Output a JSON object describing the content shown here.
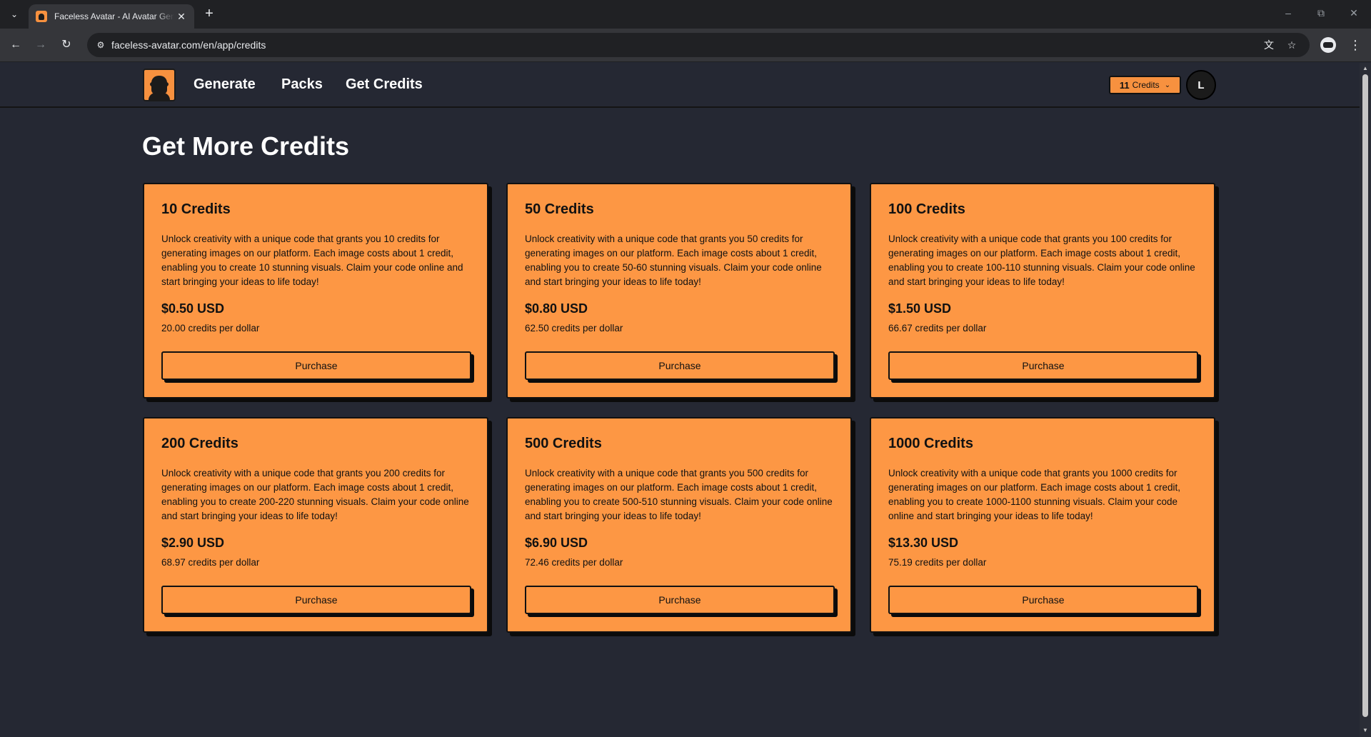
{
  "browser": {
    "tab_title": "Faceless Avatar - AI Avatar Generator",
    "url": "faceless-avatar.com/en/app/credits"
  },
  "nav": {
    "links": [
      "Generate",
      "Packs",
      "Get Credits"
    ],
    "credits_count": "11",
    "credits_label": "Credits",
    "avatar_initial": "L"
  },
  "page": {
    "title": "Get More Credits",
    "purchase_label": "Purchase"
  },
  "packs": [
    {
      "title": "10 Credits",
      "description": "Unlock creativity with a unique code that grants you 10 credits for generating images on our platform. Each image costs about 1 credit, enabling you to create 10 stunning visuals. Claim your code online and start bringing your ideas to life today!",
      "price": "$0.50 USD",
      "rate": "20.00 credits per dollar"
    },
    {
      "title": "50 Credits",
      "description": "Unlock creativity with a unique code that grants you 50 credits for generating images on our platform. Each image costs about 1 credit, enabling you to create 50-60 stunning visuals. Claim your code online and start bringing your ideas to life today!",
      "price": "$0.80 USD",
      "rate": "62.50 credits per dollar"
    },
    {
      "title": "100 Credits",
      "description": "Unlock creativity with a unique code that grants you 100 credits for generating images on our platform. Each image costs about 1 credit, enabling you to create 100-110 stunning visuals. Claim your code online and start bringing your ideas to life today!",
      "price": "$1.50 USD",
      "rate": "66.67 credits per dollar"
    },
    {
      "title": "200 Credits",
      "description": "Unlock creativity with a unique code that grants you 200 credits for generating images on our platform. Each image costs about 1 credit, enabling you to create 200-220 stunning visuals. Claim your code online and start bringing your ideas to life today!",
      "price": "$2.90 USD",
      "rate": "68.97 credits per dollar"
    },
    {
      "title": "500 Credits",
      "description": "Unlock creativity with a unique code that grants you 500 credits for generating images on our platform. Each image costs about 1 credit, enabling you to create 500-510 stunning visuals. Claim your code online and start bringing your ideas to life today!",
      "price": "$6.90 USD",
      "rate": "72.46 credits per dollar"
    },
    {
      "title": "1000 Credits",
      "description": "Unlock creativity with a unique code that grants you 1000 credits for generating images on our platform. Each image costs about 1 credit, enabling you to create 1000-1100 stunning visuals. Claim your code online and start bringing your ideas to life today!",
      "price": "$13.30 USD",
      "rate": "75.19 credits per dollar"
    }
  ],
  "colors": {
    "background": "#252833",
    "card": "#fd9744",
    "border": "#111111"
  }
}
